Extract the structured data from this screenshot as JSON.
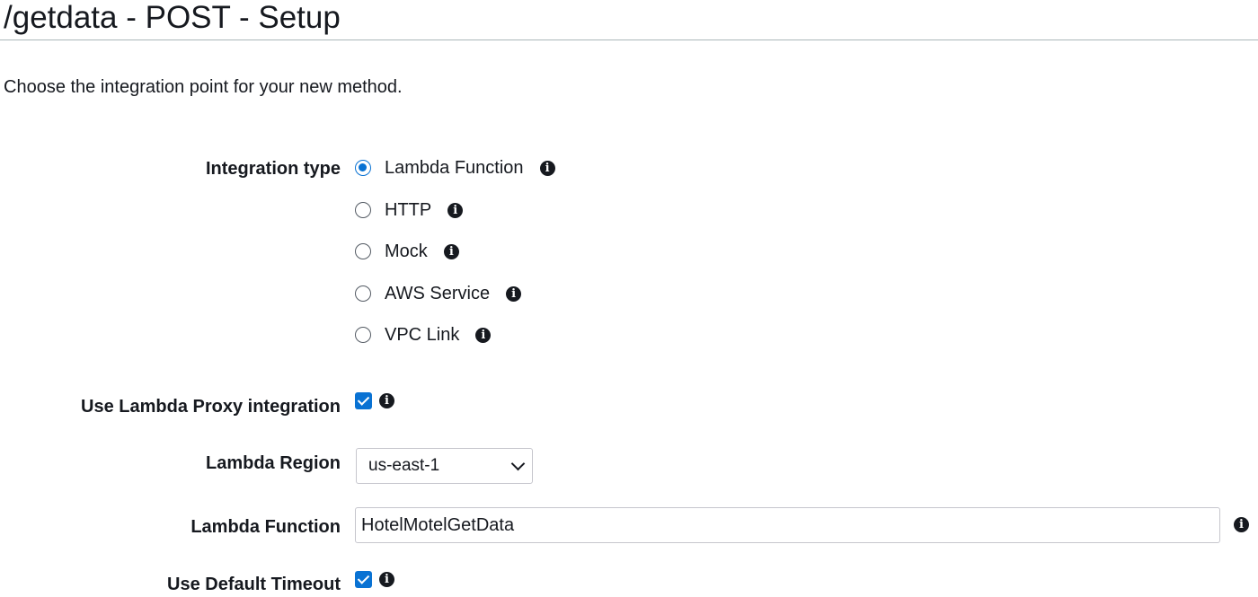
{
  "page": {
    "title": "/getdata - POST - Setup",
    "intro": "Choose the integration point for your new method."
  },
  "form": {
    "integration_type": {
      "label": "Integration type",
      "selected": "Lambda Function",
      "options": [
        {
          "label": "Lambda Function",
          "checked": true
        },
        {
          "label": "HTTP",
          "checked": false
        },
        {
          "label": "Mock",
          "checked": false
        },
        {
          "label": "AWS Service",
          "checked": false
        },
        {
          "label": "VPC Link",
          "checked": false
        }
      ]
    },
    "proxy_integration": {
      "label": "Use Lambda Proxy integration",
      "checked": true
    },
    "lambda_region": {
      "label": "Lambda Region",
      "value": "us-east-1"
    },
    "lambda_function": {
      "label": "Lambda Function",
      "value": "HotelMotelGetData"
    },
    "default_timeout": {
      "label": "Use Default Timeout",
      "checked": true
    }
  },
  "icons": {
    "info": "info-icon",
    "info_glyph": "i",
    "chevron": "chevron-down-icon"
  },
  "colors": {
    "accent": "#0972d3",
    "text": "#16191f",
    "border": "#c6c6cd"
  }
}
